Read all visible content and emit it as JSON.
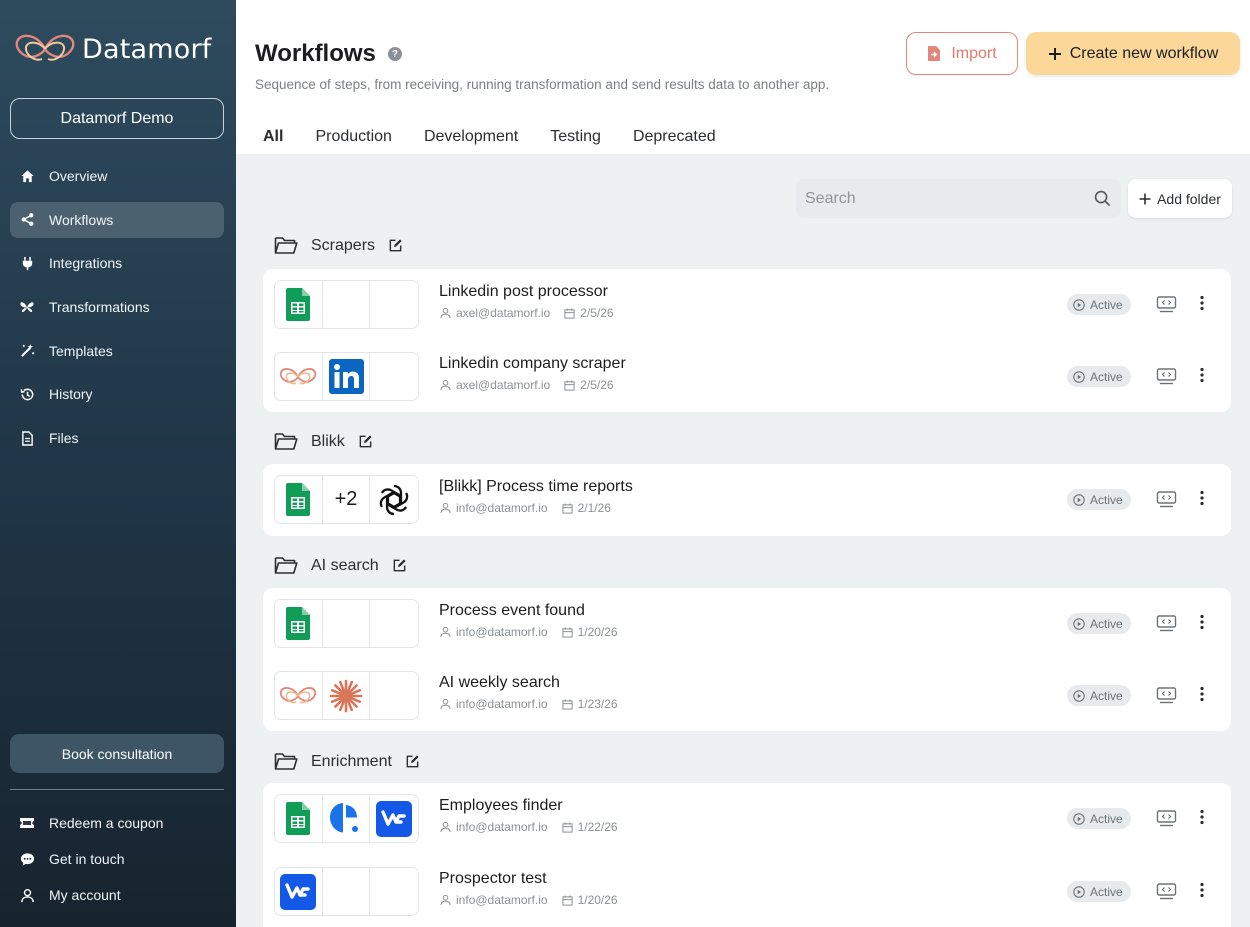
{
  "brand": {
    "name": "Datamorf",
    "accent": "#e1877b"
  },
  "workspace": {
    "name": "Datamorf Demo"
  },
  "nav": [
    {
      "label": "Overview",
      "icon": "home-icon"
    },
    {
      "label": "Workflows",
      "icon": "share-icon"
    },
    {
      "label": "Integrations",
      "icon": "plug-icon"
    },
    {
      "label": "Transformations",
      "icon": "butterfly-icon"
    },
    {
      "label": "Templates",
      "icon": "magic-wand-icon"
    },
    {
      "label": "History",
      "icon": "history-icon"
    },
    {
      "label": "Files",
      "icon": "file-icon"
    }
  ],
  "book_consultation": "Book consultation",
  "bottom_nav": [
    {
      "label": "Redeem a coupon",
      "icon": "coupon-icon"
    },
    {
      "label": "Get in touch",
      "icon": "chat-icon"
    },
    {
      "label": "My account",
      "icon": "user-icon"
    }
  ],
  "header": {
    "title": "Workflows",
    "subtitle": "Sequence of steps, from receiving, running transformation and send results data to another app.",
    "import_label": "Import",
    "create_label": "Create new workflow"
  },
  "tabs": [
    "All",
    "Production",
    "Development",
    "Testing",
    "Deprecated"
  ],
  "active_tab": "All",
  "search": {
    "placeholder": "Search"
  },
  "add_folder_label": "Add folder",
  "folders": [
    {
      "name": "Scrapers",
      "workflows": [
        {
          "name": "Linkedin post processor",
          "owner": "axel@datamorf.io",
          "date": "2/5/26",
          "status": "Active",
          "apps": [
            "google-sheets",
            "",
            ""
          ]
        },
        {
          "name": "Linkedin company scraper",
          "owner": "axel@datamorf.io",
          "date": "2/5/26",
          "status": "Active",
          "apps": [
            "datamorf",
            "linkedin",
            ""
          ]
        }
      ]
    },
    {
      "name": "Blikk",
      "workflows": [
        {
          "name": "[Blikk] Process time reports",
          "owner": "info@datamorf.io",
          "date": "2/1/26",
          "status": "Active",
          "apps": [
            "google-sheets",
            "+2",
            "openai"
          ]
        }
      ]
    },
    {
      "name": "AI search",
      "workflows": [
        {
          "name": "Process event found",
          "owner": "info@datamorf.io",
          "date": "1/20/26",
          "status": "Active",
          "apps": [
            "google-sheets",
            "",
            ""
          ]
        },
        {
          "name": "AI weekly search",
          "owner": "info@datamorf.io",
          "date": "1/23/26",
          "status": "Active",
          "apps": [
            "datamorf",
            "anthropic",
            ""
          ]
        }
      ]
    },
    {
      "name": "Enrichment",
      "workflows": [
        {
          "name": "Employees finder",
          "owner": "info@datamorf.io",
          "date": "1/22/26",
          "status": "Active",
          "apps": [
            "google-sheets",
            "bubble-app",
            "prospector"
          ]
        },
        {
          "name": "Prospector test",
          "owner": "info@datamorf.io",
          "date": "1/20/26",
          "status": "Active",
          "apps": [
            "prospector",
            "",
            ""
          ]
        }
      ]
    }
  ]
}
